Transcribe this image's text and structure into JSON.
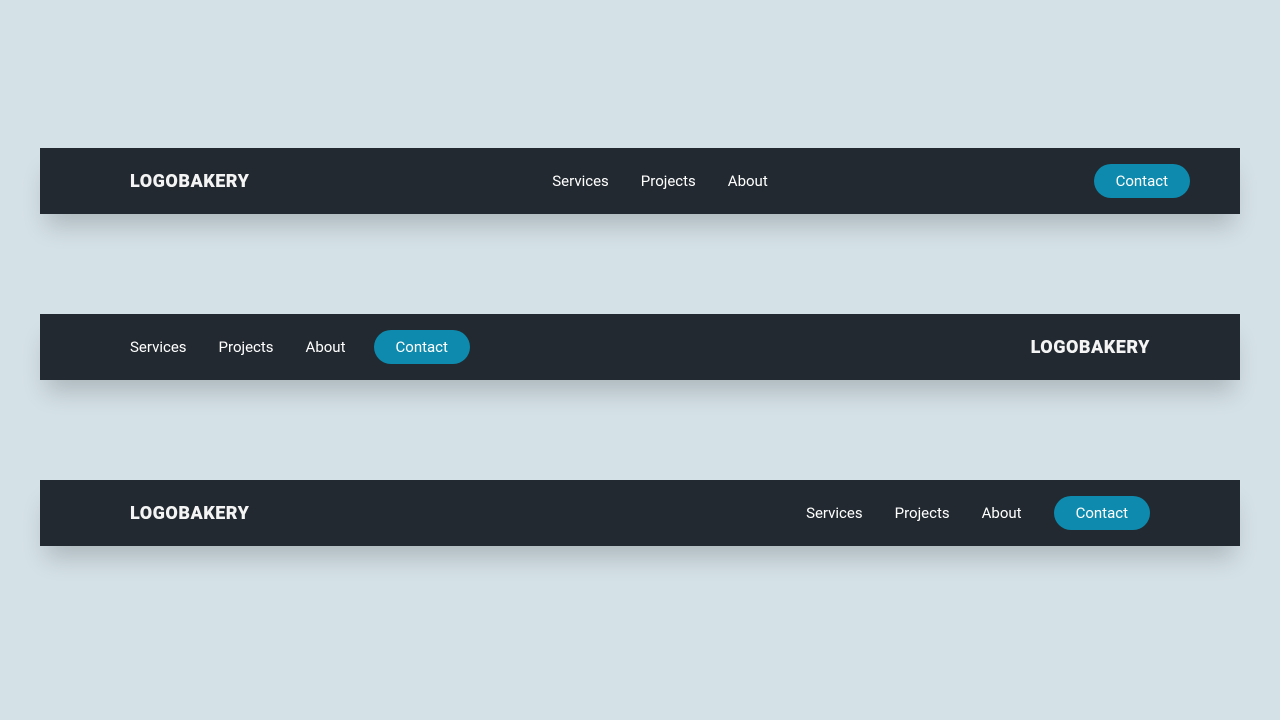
{
  "brand": "LOGOBAKERY",
  "cta": "Contact",
  "colors": {
    "bar": "#222930",
    "accent": "#0d8aad",
    "page_bg": "#d4e1e7"
  },
  "nav": {
    "items": [
      {
        "label": "Services"
      },
      {
        "label": "Projects"
      },
      {
        "label": "About"
      }
    ]
  }
}
